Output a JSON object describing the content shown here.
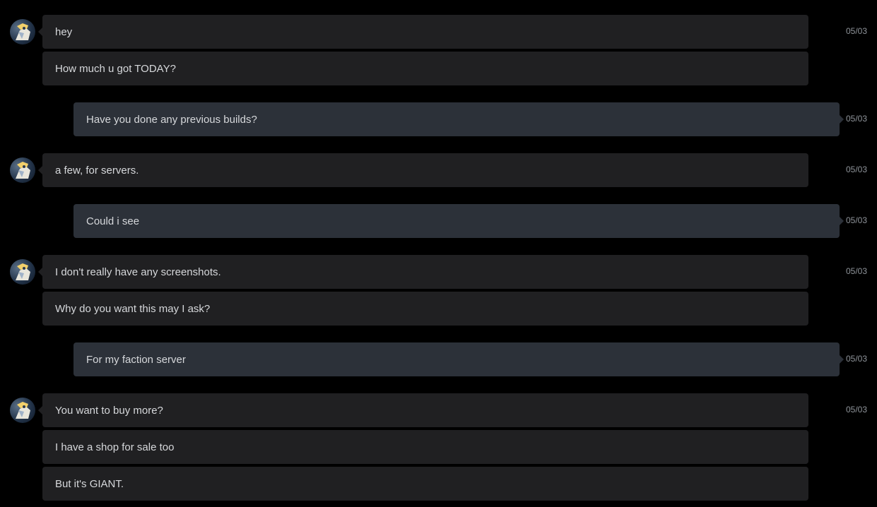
{
  "messages": [
    {
      "from": "them",
      "text": "hey",
      "time": "05/03"
    },
    {
      "from": "them",
      "text": "How much u got TODAY?"
    },
    {
      "from": "me",
      "text": "Have you done any previous builds?",
      "time": "05/03"
    },
    {
      "from": "them",
      "text": "a few, for servers.",
      "time": "05/03"
    },
    {
      "from": "me",
      "text": "Could i see",
      "time": "05/03"
    },
    {
      "from": "them",
      "text": "I don't really have any screenshots.",
      "time": "05/03"
    },
    {
      "from": "them",
      "text": "Why do you want this may I ask?"
    },
    {
      "from": "me",
      "text": "For my faction server",
      "time": "05/03"
    },
    {
      "from": "them",
      "text": "You want to buy more?",
      "time": "05/03"
    },
    {
      "from": "them",
      "text": "I have a shop for sale too"
    },
    {
      "from": "them",
      "text": "But it's GIANT."
    }
  ],
  "colors": {
    "background": "#000000",
    "incoming_bubble": "#202022",
    "outgoing_bubble": "#2c3139",
    "message_text": "#d6d8db",
    "timestamp_text": "#8f949a"
  },
  "icons": {
    "avatar": "user-avatar-icon"
  }
}
